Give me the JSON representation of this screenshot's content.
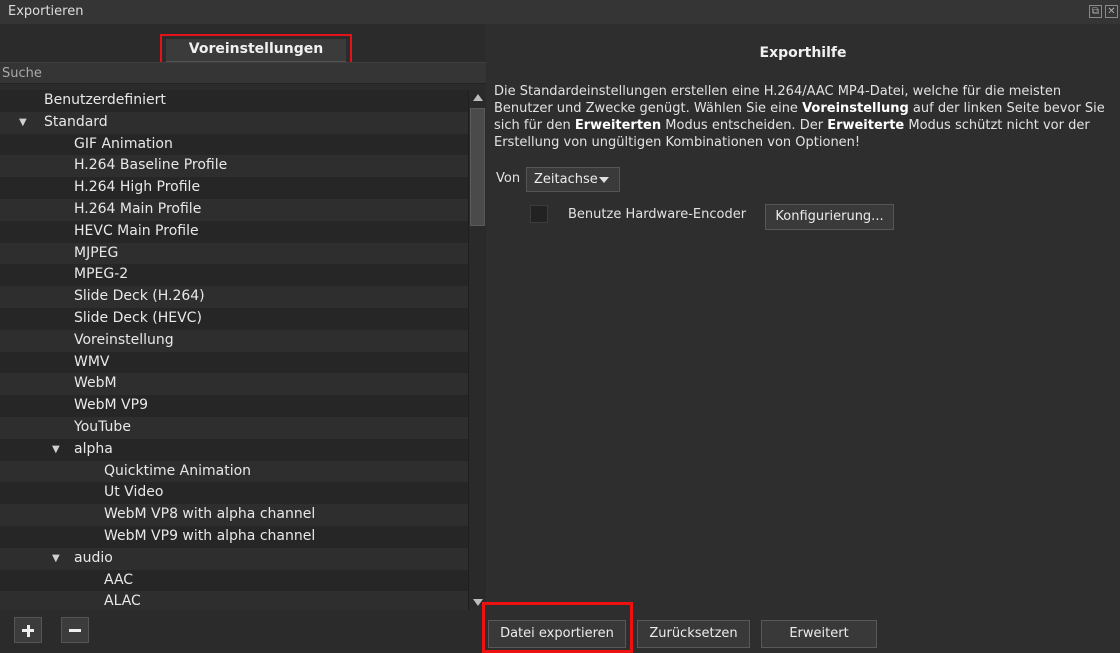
{
  "window": {
    "title": "Exportieren"
  },
  "left_panel": {
    "tab_label": "Voreinstellungen",
    "search_placeholder": "Suche",
    "tree": [
      {
        "label": "Benutzerdefiniert",
        "level": 0,
        "expanded": null
      },
      {
        "label": "Standard",
        "level": 0,
        "expanded": true
      },
      {
        "label": "GIF Animation",
        "level": 1,
        "expanded": null
      },
      {
        "label": "H.264 Baseline Profile",
        "level": 1,
        "expanded": null
      },
      {
        "label": "H.264 High Profile",
        "level": 1,
        "expanded": null
      },
      {
        "label": "H.264 Main Profile",
        "level": 1,
        "expanded": null
      },
      {
        "label": "HEVC Main Profile",
        "level": 1,
        "expanded": null
      },
      {
        "label": "MJPEG",
        "level": 1,
        "expanded": null
      },
      {
        "label": "MPEG-2",
        "level": 1,
        "expanded": null
      },
      {
        "label": "Slide Deck (H.264)",
        "level": 1,
        "expanded": null
      },
      {
        "label": "Slide Deck (HEVC)",
        "level": 1,
        "expanded": null
      },
      {
        "label": "Voreinstellung",
        "level": 1,
        "expanded": null
      },
      {
        "label": "WMV",
        "level": 1,
        "expanded": null
      },
      {
        "label": "WebM",
        "level": 1,
        "expanded": null
      },
      {
        "label": "WebM VP9",
        "level": 1,
        "expanded": null
      },
      {
        "label": "YouTube",
        "level": 1,
        "expanded": null
      },
      {
        "label": "alpha",
        "level": 1,
        "expanded": true
      },
      {
        "label": "Quicktime Animation",
        "level": 2,
        "expanded": null
      },
      {
        "label": "Ut Video",
        "level": 2,
        "expanded": null
      },
      {
        "label": "WebM VP8 with alpha channel",
        "level": 2,
        "expanded": null
      },
      {
        "label": "WebM VP9 with alpha channel",
        "level": 2,
        "expanded": null
      },
      {
        "label": "audio",
        "level": 1,
        "expanded": true
      },
      {
        "label": "AAC",
        "level": 2,
        "expanded": null
      },
      {
        "label": "ALAC",
        "level": 2,
        "expanded": null
      }
    ],
    "add_icon": "plus-icon",
    "remove_icon": "minus-icon"
  },
  "right_panel": {
    "heading": "Exporthilfe",
    "help_parts": [
      {
        "text": "Die Standardeinstellungen erstellen eine H.264/AAC MP4-Datei, welche für die meisten Benutzer und Zwecke genügt. Wählen Sie eine ",
        "bold": false
      },
      {
        "text": "Voreinstellung",
        "bold": true
      },
      {
        "text": " auf der linken Seite bevor Sie sich für den ",
        "bold": false
      },
      {
        "text": "Erweiterten",
        "bold": true
      },
      {
        "text": " Modus entscheiden. Der ",
        "bold": false
      },
      {
        "text": "Erweiterte",
        "bold": true
      },
      {
        "text": " Modus schützt nicht vor der Erstellung von ungültigen Kombinationen von Optionen!",
        "bold": false
      }
    ],
    "from_label": "Von",
    "from_value": "Zeitachse",
    "hw_encoder_label": "Benutze Hardware-Encoder",
    "hw_encoder_checked": false,
    "configure_label": "Konfigurierung..."
  },
  "bottom_buttons": {
    "export_label": "Datei exportieren",
    "reset_label": "Zurücksetzen",
    "advanced_label": "Erweitert"
  },
  "colors": {
    "highlight": "#ee1111",
    "background": "#2b2b2b"
  }
}
